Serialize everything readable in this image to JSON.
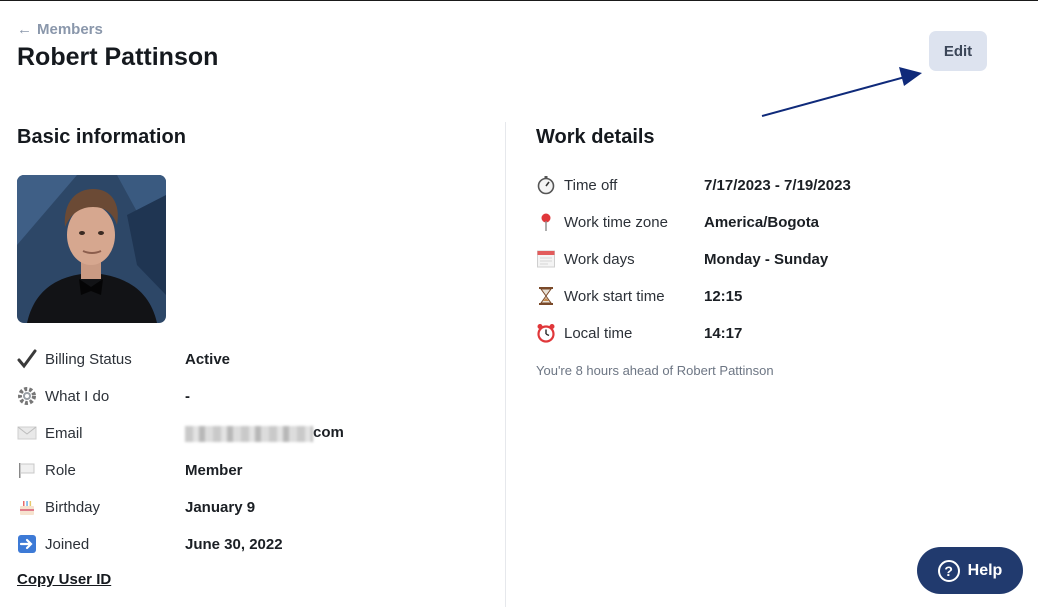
{
  "header": {
    "back_label": "Members",
    "title": "Robert Pattinson",
    "edit_label": "Edit"
  },
  "basic": {
    "title": "Basic information",
    "rows": [
      {
        "icon": "check-icon",
        "label": "Billing Status",
        "value": "Active"
      },
      {
        "icon": "gear-icon",
        "label": "What I do",
        "value": "-"
      },
      {
        "icon": "envelope-icon",
        "label": "Email",
        "value": "com"
      },
      {
        "icon": "flag-icon",
        "label": "Role",
        "value": "Member"
      },
      {
        "icon": "cake-icon",
        "label": "Birthday",
        "value": "January 9"
      },
      {
        "icon": "arrow-right-icon",
        "label": "Joined",
        "value": "June 30, 2022"
      }
    ],
    "copy_label": "Copy User ID"
  },
  "work": {
    "title": "Work details",
    "rows": [
      {
        "icon": "stopwatch-icon",
        "label": "Time off",
        "value": "7/17/2023 - 7/19/2023"
      },
      {
        "icon": "pin-icon",
        "label": "Work time zone",
        "value": "America/Bogota"
      },
      {
        "icon": "calendar-icon",
        "label": "Work days",
        "value": "Monday - Sunday"
      },
      {
        "icon": "hourglass-icon",
        "label": "Work start time",
        "value": "12:15"
      },
      {
        "icon": "alarm-clock-icon",
        "label": "Local time",
        "value": "14:17"
      }
    ],
    "note": "You're 8 hours ahead of Robert Pattinson"
  },
  "help": {
    "label": "Help"
  },
  "colors": {
    "accent_navy": "#213a6e",
    "edit_bg": "#dde3ef",
    "annotation_arrow": "#0f2a7a"
  }
}
